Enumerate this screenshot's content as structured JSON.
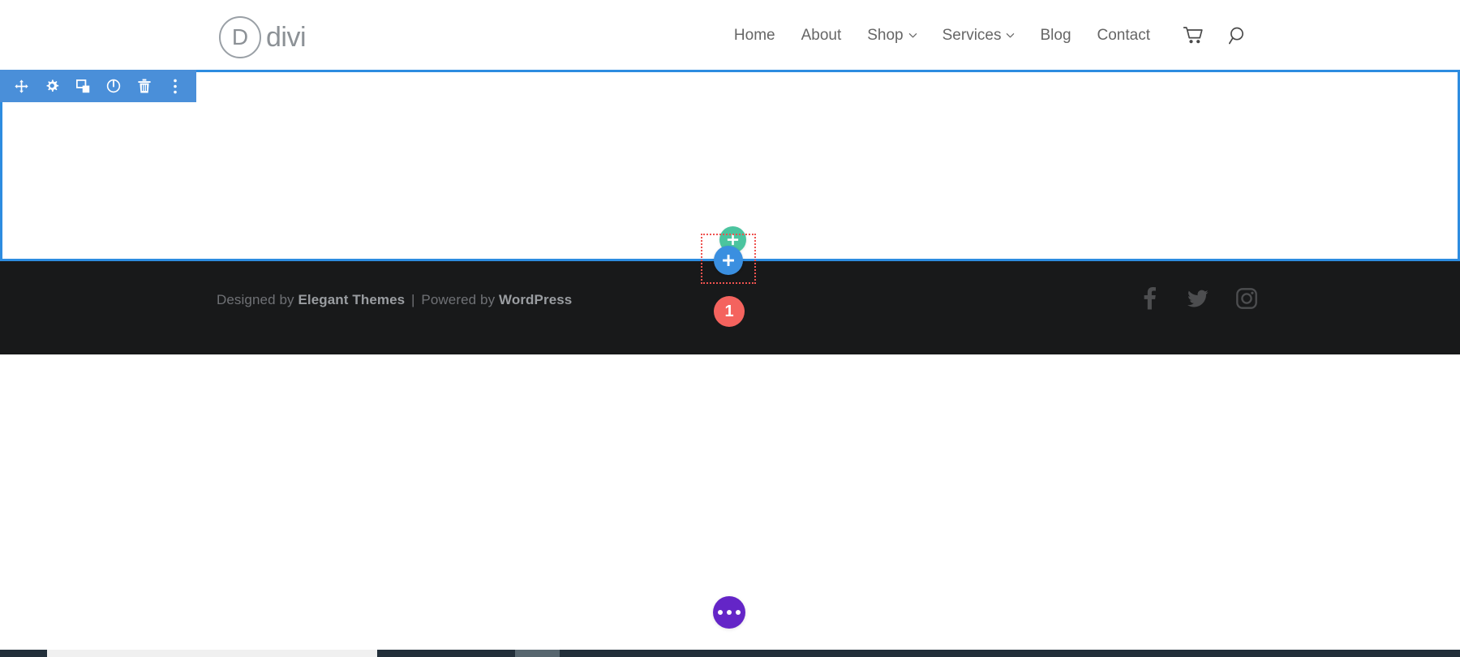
{
  "header": {
    "logo": {
      "mark_letter": "D",
      "text": "divi",
      "icon": "divi-logo-icon"
    },
    "nav": [
      {
        "label": "Home",
        "has_dropdown": false,
        "name": "nav-item-home"
      },
      {
        "label": "About",
        "has_dropdown": false,
        "name": "nav-item-about"
      },
      {
        "label": "Shop",
        "has_dropdown": true,
        "name": "nav-item-shop"
      },
      {
        "label": "Services",
        "has_dropdown": true,
        "name": "nav-item-services"
      },
      {
        "label": "Blog",
        "has_dropdown": false,
        "name": "nav-item-blog"
      },
      {
        "label": "Contact",
        "has_dropdown": false,
        "name": "nav-item-contact"
      }
    ],
    "icons": [
      {
        "name": "cart-icon",
        "label": "Cart"
      },
      {
        "name": "search-icon",
        "label": "Search"
      }
    ]
  },
  "builder": {
    "section_toolbar": [
      {
        "name": "move-icon",
        "label": "Move Section"
      },
      {
        "name": "gear-icon",
        "label": "Section Settings"
      },
      {
        "name": "duplicate-icon",
        "label": "Duplicate Section"
      },
      {
        "name": "power-icon",
        "label": "Disable Section"
      },
      {
        "name": "trash-icon",
        "label": "Delete Section"
      },
      {
        "name": "more-vertical-icon",
        "label": "More Options"
      }
    ],
    "add_row_button": {
      "name": "add-row-button",
      "label": "+",
      "color": "#4bc49f"
    },
    "add_section_button": {
      "name": "add-section-button",
      "label": "+",
      "color": "#3a8fe0"
    },
    "drop_zone": {
      "name": "drop-zone",
      "border_color": "#ef5350"
    },
    "count_badge": {
      "name": "count-badge",
      "value": "1",
      "color": "#f4635e"
    },
    "more_button": {
      "name": "more-options-button",
      "label": "•••",
      "color": "#6425c7"
    },
    "section_border_color": "#2d8ce0",
    "toolbar_bg": "#4a8fd9"
  },
  "footer": {
    "credit": {
      "prefix": "Designed by",
      "brand": "Elegant Themes",
      "separator": "|",
      "middle": "Powered by",
      "platform": "WordPress"
    },
    "social": [
      {
        "name": "facebook-icon",
        "label": "Facebook"
      },
      {
        "name": "twitter-icon",
        "label": "Twitter"
      },
      {
        "name": "instagram-icon",
        "label": "Instagram"
      }
    ],
    "background": "#18191a"
  },
  "bottom_bar": {
    "name": "bottom-status-bar",
    "background": "#222f3a",
    "progress_color": "#f0f0f0",
    "segment_color": "#57666f"
  }
}
